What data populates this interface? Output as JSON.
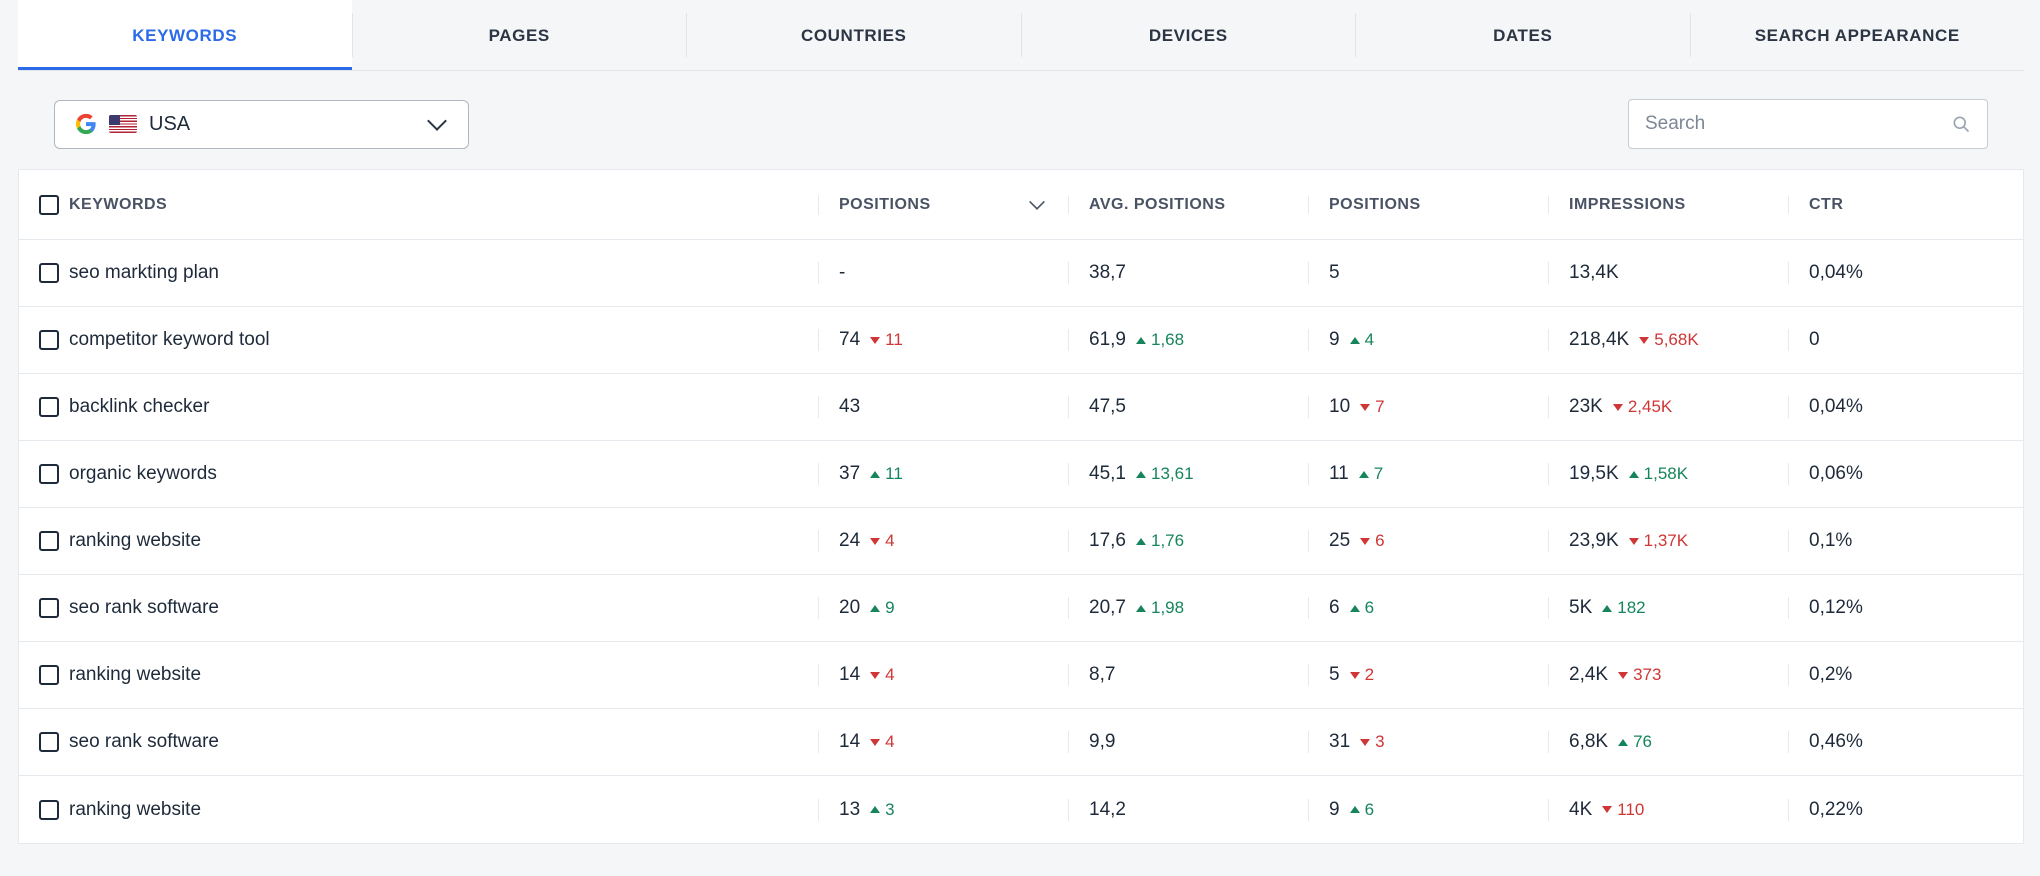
{
  "tabs": [
    "KEYWORDS",
    "PAGES",
    "COUNTRIES",
    "DEVICES",
    "DATES",
    "SEARCH APPEARANCE"
  ],
  "active_tab": 0,
  "country": {
    "label": "USA"
  },
  "search": {
    "placeholder": "Search"
  },
  "columns": [
    "KEYWORDS",
    "POSITIONS",
    "AVG. POSITIONS",
    "POSITIONS",
    "IMPRESSIONS",
    "CTR"
  ],
  "rows": [
    {
      "kw": "seo markting plan",
      "pos": "-",
      "pos_d": null,
      "avg": "38,7",
      "avg_d": null,
      "pos2": "5",
      "pos2_d": null,
      "imp": "13,4K",
      "imp_d": null,
      "ctr": "0,04%"
    },
    {
      "kw": "competitor keyword tool",
      "pos": "74",
      "pos_d": {
        "dir": "down",
        "v": "11"
      },
      "avg": "61,9",
      "avg_d": {
        "dir": "up",
        "v": "1,68"
      },
      "pos2": "9",
      "pos2_d": {
        "dir": "up",
        "v": "4"
      },
      "imp": "218,4K",
      "imp_d": {
        "dir": "down",
        "v": "5,68K"
      },
      "ctr": "0"
    },
    {
      "kw": "backlink checker",
      "pos": "43",
      "pos_d": null,
      "avg": "47,5",
      "avg_d": null,
      "pos2": "10",
      "pos2_d": {
        "dir": "down",
        "v": "7"
      },
      "imp": "23K",
      "imp_d": {
        "dir": "down",
        "v": "2,45K"
      },
      "ctr": "0,04%"
    },
    {
      "kw": "organic keywords",
      "pos": "37",
      "pos_d": {
        "dir": "up",
        "v": "11"
      },
      "avg": "45,1",
      "avg_d": {
        "dir": "up",
        "v": "13,61"
      },
      "pos2": "11",
      "pos2_d": {
        "dir": "up",
        "v": "7"
      },
      "imp": "19,5K",
      "imp_d": {
        "dir": "up",
        "v": "1,58K"
      },
      "ctr": "0,06%"
    },
    {
      "kw": "ranking website",
      "pos": "24",
      "pos_d": {
        "dir": "down",
        "v": "4"
      },
      "avg": "17,6",
      "avg_d": {
        "dir": "up",
        "v": "1,76"
      },
      "pos2": "25",
      "pos2_d": {
        "dir": "down",
        "v": "6"
      },
      "imp": "23,9K",
      "imp_d": {
        "dir": "down",
        "v": "1,37K"
      },
      "ctr": "0,1%"
    },
    {
      "kw": "seo rank software",
      "pos": "20",
      "pos_d": {
        "dir": "up",
        "v": "9"
      },
      "avg": "20,7",
      "avg_d": {
        "dir": "up",
        "v": "1,98"
      },
      "pos2": "6",
      "pos2_d": {
        "dir": "up",
        "v": "6"
      },
      "imp": "5K",
      "imp_d": {
        "dir": "up",
        "v": "182"
      },
      "ctr": "0,12%"
    },
    {
      "kw": "ranking website",
      "pos": "14",
      "pos_d": {
        "dir": "down",
        "v": "4"
      },
      "avg": "8,7",
      "avg_d": null,
      "pos2": "5",
      "pos2_d": {
        "dir": "down",
        "v": "2"
      },
      "imp": "2,4K",
      "imp_d": {
        "dir": "down",
        "v": "373"
      },
      "ctr": "0,2%"
    },
    {
      "kw": "seo rank software",
      "pos": "14",
      "pos_d": {
        "dir": "down",
        "v": "4"
      },
      "avg": "9,9",
      "avg_d": null,
      "pos2": "31",
      "pos2_d": {
        "dir": "down",
        "v": "3"
      },
      "imp": "6,8K",
      "imp_d": {
        "dir": "up",
        "v": "76"
      },
      "ctr": "0,46%"
    },
    {
      "kw": "ranking website",
      "pos": "13",
      "pos_d": {
        "dir": "up",
        "v": "3"
      },
      "avg": "14,2",
      "avg_d": null,
      "pos2": "9",
      "pos2_d": {
        "dir": "up",
        "v": "6"
      },
      "imp": "4K",
      "imp_d": {
        "dir": "down",
        "v": "110"
      },
      "ctr": "0,22%"
    }
  ]
}
